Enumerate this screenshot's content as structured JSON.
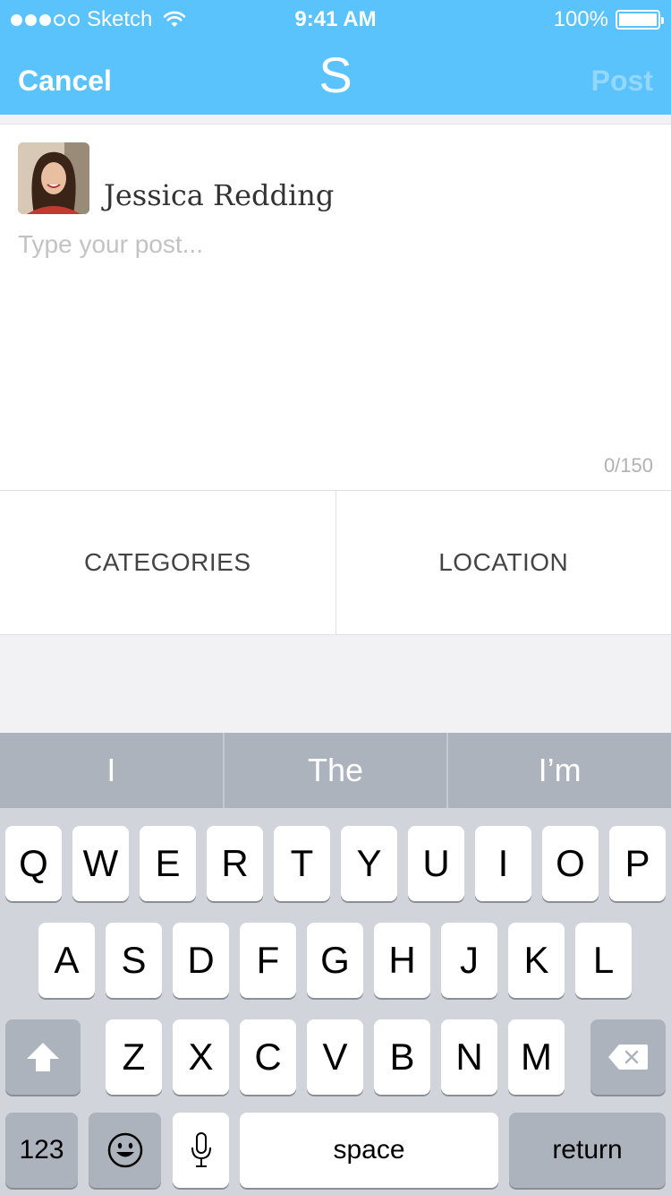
{
  "status_bar": {
    "carrier": "Sketch",
    "time": "9:41 AM",
    "battery": "100%",
    "signal_bars_filled": 3,
    "signal_bars_total": 5
  },
  "nav": {
    "cancel": "Cancel",
    "logo": "S",
    "post": "Post"
  },
  "composer": {
    "user_name": "Jessica Redding",
    "placeholder": "Type your post...",
    "value": "",
    "char_count": "0/150"
  },
  "options": {
    "categories": "CATEGORIES",
    "location": "LOCATION"
  },
  "keyboard": {
    "suggestions": [
      "I",
      "The",
      "I’m"
    ],
    "row1": [
      "Q",
      "W",
      "E",
      "R",
      "T",
      "Y",
      "U",
      "I",
      "O",
      "P"
    ],
    "row2": [
      "A",
      "S",
      "D",
      "F",
      "G",
      "H",
      "J",
      "K",
      "L"
    ],
    "row3": [
      "Z",
      "X",
      "C",
      "V",
      "B",
      "N",
      "M"
    ],
    "numbers_key": "123",
    "space_key": "space",
    "return_key": "return"
  },
  "colors": {
    "brand": "#5ac3fb",
    "keyboard_bg": "#d1d5db",
    "suggestion_bar": "#acb3bc"
  }
}
